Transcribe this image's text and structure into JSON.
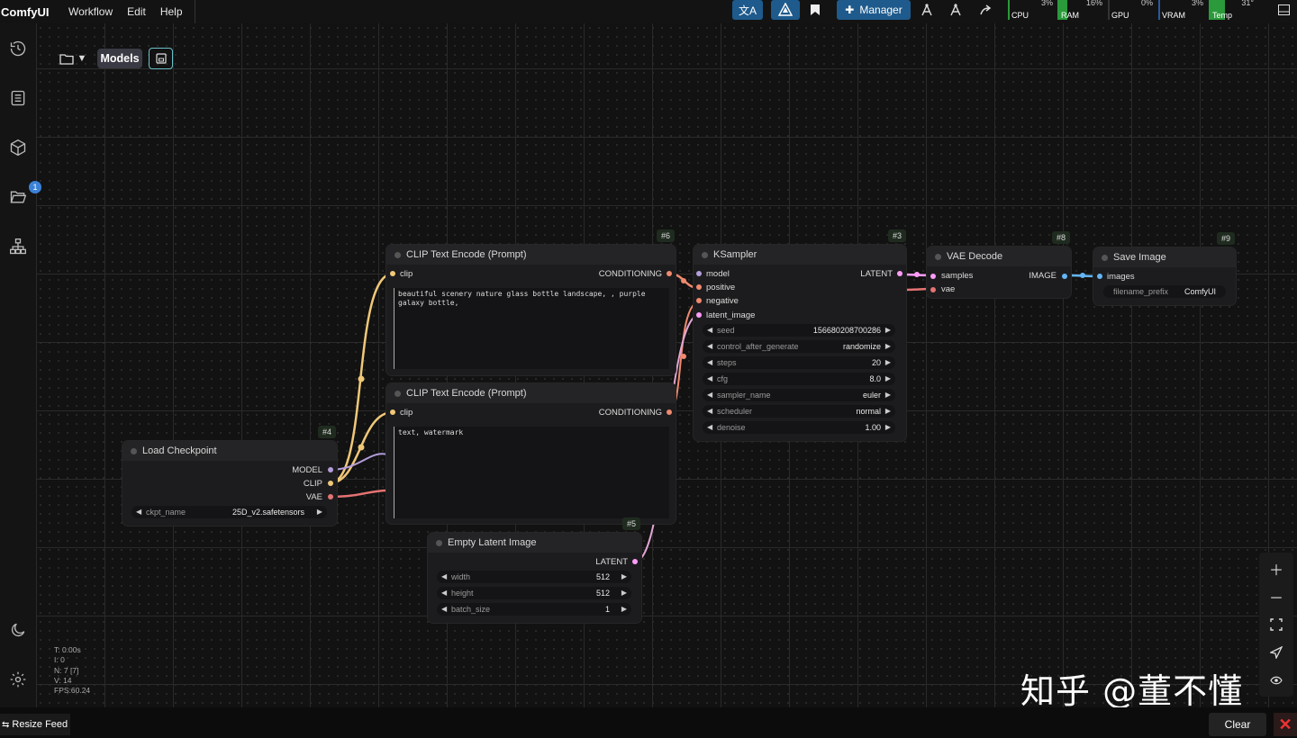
{
  "app": {
    "brand": "ComfyUI"
  },
  "menu": [
    "Workflow",
    "Edit",
    "Help"
  ],
  "topbar": {
    "manager_label": "Manager",
    "monitors": [
      {
        "label": "CPU",
        "value": "3%",
        "fill": 0.03
      },
      {
        "label": "RAM",
        "value": "16%",
        "fill": 0.16
      },
      {
        "label": "GPU",
        "value": "0%",
        "fill": 0.0
      },
      {
        "label": "VRAM",
        "value": "3%",
        "fill": 0.03
      },
      {
        "label": "Temp",
        "value": "31°",
        "fill": 0.31
      }
    ]
  },
  "sidebar": {
    "queue_badge": "1"
  },
  "toolbar": {
    "models_label": "Models"
  },
  "nodes": {
    "clip_pos": {
      "title": "CLIP Text Encode (Prompt)",
      "id": "#6",
      "in": "clip",
      "out": "CONDITIONING",
      "text": "beautiful scenery nature glass bottle landscape, , purple galaxy bottle,"
    },
    "clip_neg": {
      "title": "CLIP Text Encode (Prompt)",
      "in": "clip",
      "out": "CONDITIONING",
      "text": "text, watermark"
    },
    "ksampler": {
      "title": "KSampler",
      "id": "#3",
      "inputs": [
        "model",
        "positive",
        "negative",
        "latent_image"
      ],
      "out": "LATENT",
      "widgets": [
        {
          "label": "seed",
          "value": "156680208700286"
        },
        {
          "label": "control_after_generate",
          "value": "randomize"
        },
        {
          "label": "steps",
          "value": "20"
        },
        {
          "label": "cfg",
          "value": "8.0"
        },
        {
          "label": "sampler_name",
          "value": "euler"
        },
        {
          "label": "scheduler",
          "value": "normal"
        },
        {
          "label": "denoise",
          "value": "1.00"
        }
      ]
    },
    "vae_decode": {
      "title": "VAE Decode",
      "id": "#8",
      "inputs": [
        "samples",
        "vae"
      ],
      "out": "IMAGE"
    },
    "save_image": {
      "title": "Save Image",
      "id": "#9",
      "in": "images",
      "widget_label": "filename_prefix",
      "widget_value": "ComfyUI"
    },
    "load_ckpt": {
      "title": "Load Checkpoint",
      "id": "#4",
      "outputs": [
        "MODEL",
        "CLIP",
        "VAE"
      ],
      "widget_label": "ckpt_name",
      "widget_value": "25D_v2.safetensors"
    },
    "empty_latent": {
      "title": "Empty Latent Image",
      "id": "#5",
      "out": "LATENT",
      "widgets": [
        {
          "label": "width",
          "value": "512"
        },
        {
          "label": "height",
          "value": "512"
        },
        {
          "label": "batch_size",
          "value": "1"
        }
      ]
    }
  },
  "stats": [
    "T: 0.00s",
    "I: 0",
    "N: 7 [7]",
    "V: 14",
    "FPS:60.24"
  ],
  "watermark": "知乎 @董不懂",
  "bottom": {
    "resize_feed": "Resize Feed",
    "clear": "Clear",
    "close": "✕"
  },
  "colors": {
    "accent": "#1e5a8c",
    "clip_link": "#f0c877",
    "model_link": "#b39ddb",
    "vae_link": "#e57373",
    "cond_link": "#f08a6e",
    "latent_link": "#ff9cf9",
    "image_link": "#64b5f6"
  }
}
